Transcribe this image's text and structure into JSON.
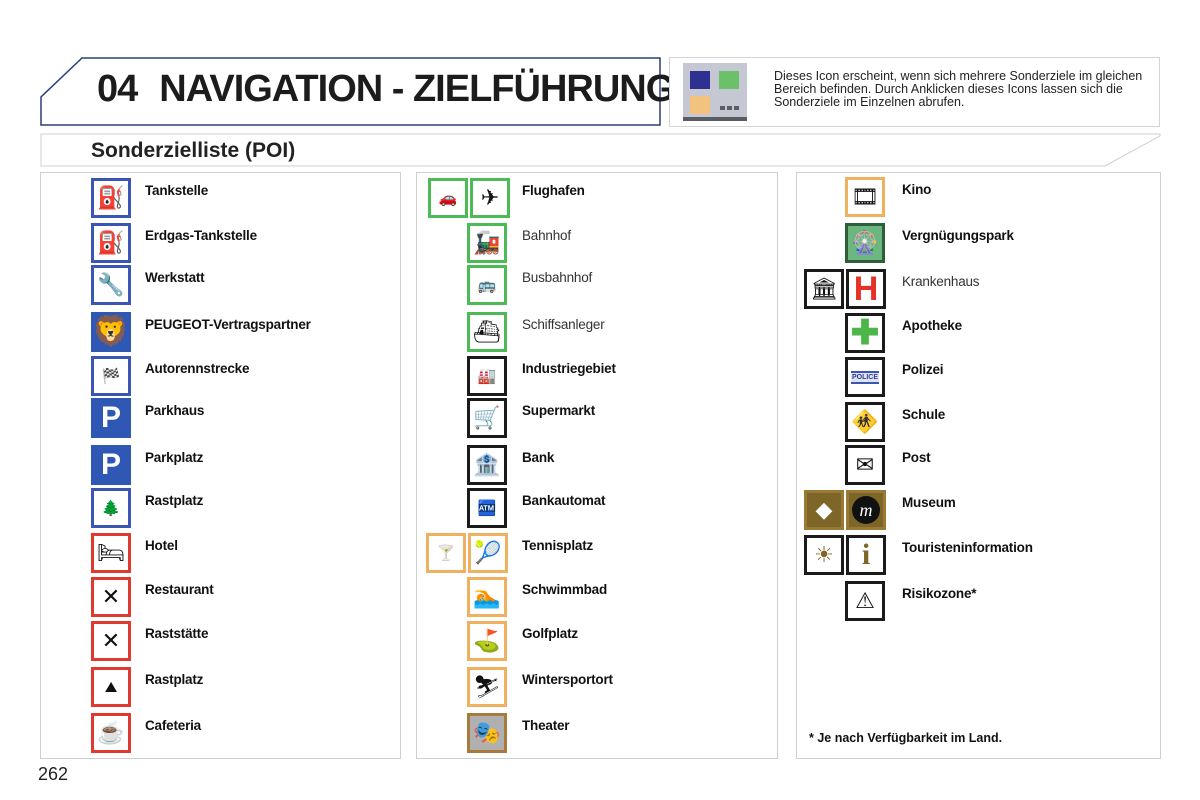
{
  "chapter": {
    "number": "04",
    "title": "NAVIGATION - ZIELFÜHRUNG"
  },
  "info": {
    "icon": "poi-cluster-icon",
    "text": "Dieses Icon erscheint, wenn sich mehrere Sonderziele im gleichen Bereich befinden. Durch Anklicken dieses Icons lassen sich die Sonderziele im Einzelnen abrufen."
  },
  "section": {
    "title": "Sonderzielliste (POI)"
  },
  "columns": [
    {
      "items": [
        {
          "label": "Tankstelle",
          "icons": [
            "fuel-pump-icon"
          ]
        },
        {
          "label": "Erdgas-Tankstelle",
          "icons": [
            "gas-fuel-pump-icon"
          ]
        },
        {
          "label": "Werkstatt",
          "icons": [
            "wrench-icon"
          ]
        },
        {
          "label": "PEUGEOT-Vertragspartner",
          "icons": [
            "peugeot-lion-icon"
          ]
        },
        {
          "label": "Autorennstrecke",
          "icons": [
            "race-track-icon"
          ]
        },
        {
          "label": "Parkhaus",
          "icons": [
            "parking-garage-icon"
          ]
        },
        {
          "label": "Parkplatz",
          "icons": [
            "parking-icon"
          ]
        },
        {
          "label": "Rastplatz",
          "icons": [
            "rest-area-icon"
          ]
        },
        {
          "label": "Hotel",
          "icons": [
            "bed-icon"
          ]
        },
        {
          "label": "Restaurant",
          "icons": [
            "cutlery-icon"
          ]
        },
        {
          "label": "Raststätte",
          "icons": [
            "roadside-restaurant-icon"
          ]
        },
        {
          "label": "Rastplatz",
          "icons": [
            "picnic-area-icon"
          ]
        },
        {
          "label": "Cafeteria",
          "icons": [
            "coffee-cup-icon"
          ]
        }
      ]
    },
    {
      "items": [
        {
          "label": "Flughafen",
          "icons": [
            "transport-group-icon",
            "airplane-icon"
          ]
        },
        {
          "label": "Bahnhof",
          "icons": [
            "train-icon"
          ]
        },
        {
          "label": "Busbahnhof",
          "icons": [
            "bus-icon"
          ]
        },
        {
          "label": "Schiffsanleger",
          "icons": [
            "ferry-icon"
          ]
        },
        {
          "label": "Industriegebiet",
          "icons": [
            "industry-group-icon"
          ]
        },
        {
          "label": "Supermarkt",
          "icons": [
            "shopping-cart-icon"
          ]
        },
        {
          "label": "Bank",
          "icons": [
            "bank-icon"
          ]
        },
        {
          "label": "Bankautomat",
          "icons": [
            "atm-icon"
          ]
        },
        {
          "label": "Tennisplatz",
          "icons": [
            "leisure-group-icon",
            "tennis-icon"
          ]
        },
        {
          "label": "Schwimmbad",
          "icons": [
            "swimmer-icon"
          ]
        },
        {
          "label": "Golfplatz",
          "icons": [
            "golfer-icon"
          ]
        },
        {
          "label": "Wintersportort",
          "icons": [
            "skier-icon"
          ]
        },
        {
          "label": "Theater",
          "icons": [
            "theater-icon"
          ]
        }
      ]
    },
    {
      "items": [
        {
          "label": "Kino",
          "icons": [
            "film-icon"
          ]
        },
        {
          "label": "Vergnügungspark",
          "icons": [
            "ferris-wheel-icon"
          ]
        },
        {
          "label": "Krankenhaus",
          "icons": [
            "public-building-icon",
            "hospital-icon"
          ]
        },
        {
          "label": "Apotheke",
          "icons": [
            "pharmacy-cross-icon"
          ]
        },
        {
          "label": "Polizei",
          "icons": [
            "police-icon"
          ]
        },
        {
          "label": "Schule",
          "icons": [
            "school-children-icon"
          ]
        },
        {
          "label": "Post",
          "icons": [
            "envelope-icon"
          ]
        },
        {
          "label": "Museum",
          "icons": [
            "culture-group-icon",
            "museum-icon"
          ]
        },
        {
          "label": "Touristeninformation",
          "icons": [
            "sightseeing-group-icon",
            "info-icon"
          ]
        },
        {
          "label": "Risikozone*",
          "icons": [
            "warning-zone-icon"
          ]
        }
      ],
      "footnote": "* Je nach Verfügbarkeit im Land."
    }
  ],
  "page_number": "262",
  "colors": {
    "blue_frame": "#3a55b4",
    "red_frame": "#e03a30",
    "green_frame": "#4cbb55",
    "orange_frame": "#efb160",
    "brown": "#7d6628",
    "chapter_border": "#2c3e7a"
  }
}
